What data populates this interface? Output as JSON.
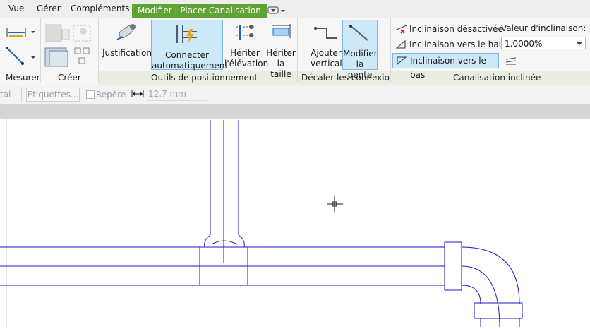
{
  "tabs": [
    "Vue",
    "Gérer",
    "Compléments",
    "Modifier | Placer Canalisation"
  ],
  "active_tab_index": 3,
  "panels": {
    "mesurer": "Mesurer",
    "creer": "Créer",
    "outils": "Outils de positionnement",
    "decaler": "Décaler les connexions",
    "canal": "Canalisation inclinée"
  },
  "buttons": {
    "justification": "Justification",
    "connecter_1": "Connecter",
    "connecter_2": "automatiquement",
    "heriter_elev_1": "Hériter",
    "heriter_elev_2": "l'élévation",
    "heriter_taille_1": "Hériter",
    "heriter_taille_2": "la taille",
    "ajouter_1": "Ajouter",
    "ajouter_2": "vertical",
    "modifier_1": "Modifier",
    "modifier_2": "la pente"
  },
  "inclinaison": {
    "desactivee": "Inclinaison désactivée",
    "haut": "Inclinaison vers le haut",
    "bas": "Inclinaison vers le bas",
    "valeur_label": "Valeur d'inclinaison:",
    "valeur": "1.0000%"
  },
  "options": {
    "left_text": "tal",
    "etiquettes": "Etiquettes...",
    "repere": "Repère",
    "dimension": "12.7 mm"
  },
  "colors": {
    "active_tab": "#5ea334",
    "selection": "#cde8f6",
    "pipe_lines": "#1a1acc"
  }
}
